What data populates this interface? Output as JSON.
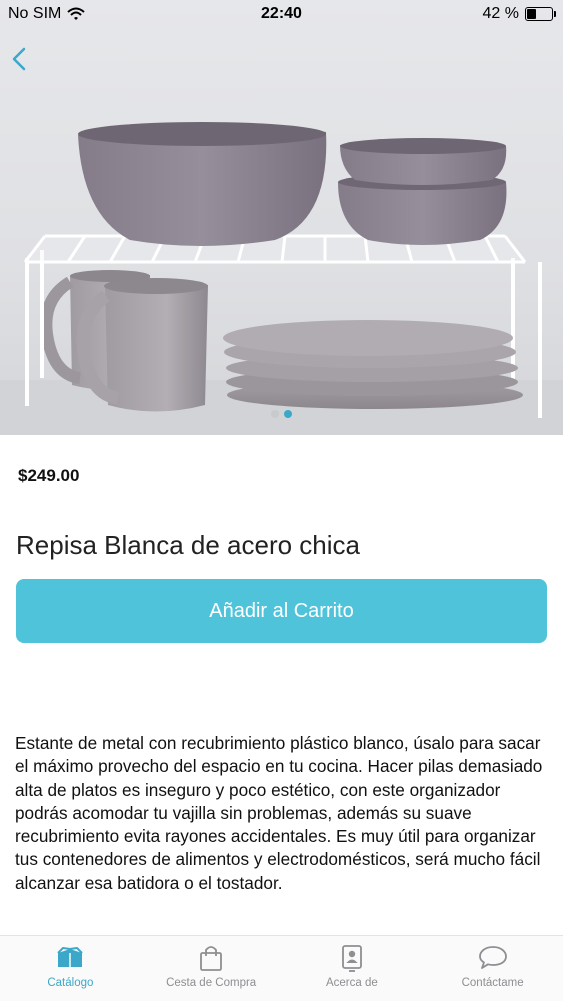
{
  "status_bar": {
    "carrier": "No SIM",
    "time": "22:40",
    "battery_percent": "42 %",
    "battery_level": 0.42
  },
  "gallery": {
    "image_subject": "white wire shelf with purple-grey bowls, mugs and plates",
    "page_count": 2,
    "active_page": 2
  },
  "product": {
    "price": "$249.00",
    "title": "Repisa Blanca de acero chica",
    "add_to_cart_label": "Añadir al Carrito",
    "description": "Estante de metal con recubrimiento plástico blanco, úsalo para sacar el máximo provecho del espacio en tu cocina. Hacer pilas demasiado alta de platos es inseguro y poco estético, con este organizador podrás acomodar tu vajilla sin problemas, además su suave recubrimiento evita rayones accidentales. Es muy útil para organizar tus contenedores de alimentos y electrodomésticos, será mucho fácil alcanzar esa batidora o el tostador."
  },
  "tabs": [
    {
      "label": "Catálogo",
      "icon": "box-icon",
      "active": true
    },
    {
      "label": "Cesta de Compra",
      "icon": "shopping-bag-icon",
      "active": false
    },
    {
      "label": "Acerca de",
      "icon": "contact-badge-icon",
      "active": false
    },
    {
      "label": "Contáctame",
      "icon": "speech-bubble-icon",
      "active": false
    }
  ],
  "colors": {
    "accent": "#4fc3d9",
    "active_tab": "#3ba8c9",
    "inactive_tab": "#8e8e93",
    "dish_color": "#8a8290"
  }
}
